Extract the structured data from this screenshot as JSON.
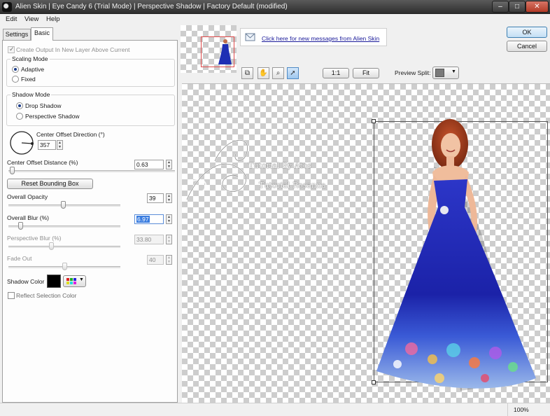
{
  "window": {
    "title": "Alien Skin | Eye Candy 6 (Trial Mode) | Perspective Shadow | Factory Default (modified)",
    "minimize_glyph": "–",
    "maximize_glyph": "□",
    "close_glyph": "✕"
  },
  "menu": [
    "Edit",
    "View",
    "Help"
  ],
  "tabs": [
    "Settings",
    "Basic"
  ],
  "basic": {
    "create_output_label": "Create Output In New Layer Above Current",
    "scaling_mode": {
      "label": "Scaling Mode",
      "options": [
        "Adaptive",
        "Fixed"
      ],
      "selected": "Adaptive"
    },
    "shadow_mode": {
      "label": "Shadow Mode",
      "options": [
        "Drop Shadow",
        "Perspective Shadow"
      ],
      "selected": "Drop Shadow"
    },
    "center_offset_direction": {
      "label": "Center Offset Direction (°)",
      "value": "357"
    },
    "center_offset_distance": {
      "label": "Center Offset Distance (%)",
      "value": "0.63",
      "slider": 0.02
    },
    "reset_button": "Reset Bounding Box",
    "overall_opacity": {
      "label": "Overall Opacity",
      "value": "39",
      "slider": 0.39
    },
    "overall_blur": {
      "label": "Overall Blur (%)",
      "value": "6.97",
      "slider": 0.07
    },
    "perspective_blur": {
      "label": "Perspective Blur (%)",
      "value": "33.80",
      "slider": 0.34
    },
    "fade_out": {
      "label": "Fade Out",
      "value": "40",
      "slider": 0.4
    },
    "shadow_color": {
      "label": "Shadow Color",
      "color": "#000000"
    },
    "reflect_label": "Reflect Selection Color"
  },
  "preview": {
    "message_link": "Click here for new messages from Alien Skin",
    "zoom_1to1": "1:1",
    "zoom_fit": "Fit",
    "preview_split_label": "Preview Split:",
    "preview_split_color": "#7a7a7a",
    "tools": [
      "copy-icon",
      "hand-icon",
      "zoom-icon",
      "pointer-icon"
    ],
    "watermark_line1": "Tutorial By Atos",
    "watermark_line2": "Tutorial Rosanna"
  },
  "dialog": {
    "ok": "OK",
    "cancel": "Cancel"
  },
  "status": {
    "zoom": "100%"
  }
}
